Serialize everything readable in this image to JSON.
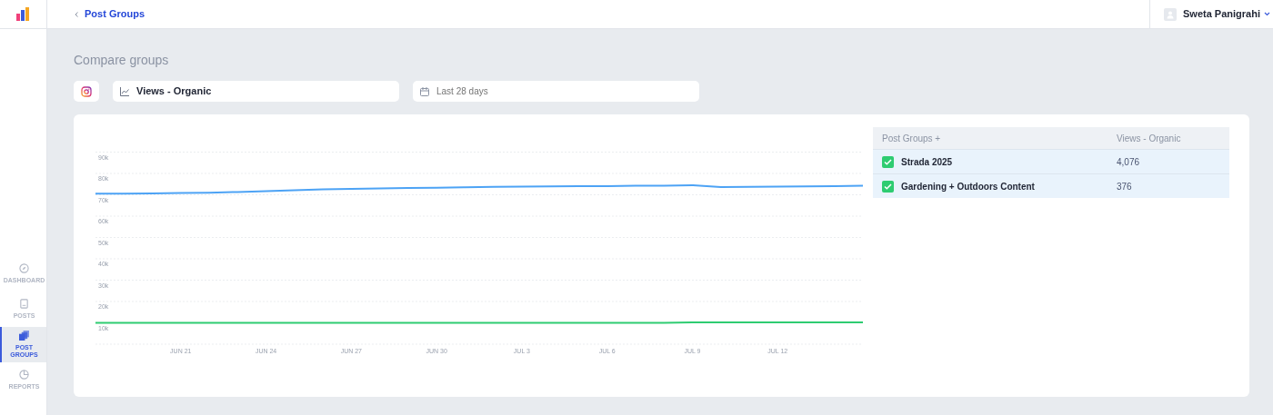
{
  "topbar": {
    "back_link": "Post Groups",
    "user_name": "Sweta Panigrahi"
  },
  "sidebar": {
    "items": [
      {
        "label": "DASHBOARD",
        "selected": false
      },
      {
        "label": "POSTS",
        "selected": false
      },
      {
        "label": "POST GROUPS",
        "selected": true
      },
      {
        "label": "REPORTS",
        "selected": false
      }
    ]
  },
  "page_title": "Compare groups",
  "filters": {
    "metric": "Views - Organic",
    "date_placeholder": "Last 28 days"
  },
  "chart_data": {
    "type": "line",
    "grid": true,
    "categories": [
      null,
      null,
      null,
      "JUN 21",
      null,
      null,
      "JUN 24",
      null,
      null,
      "JUN 27",
      null,
      null,
      "JUN 30",
      null,
      null,
      "JUL 3",
      null,
      null,
      "JUL 6",
      null,
      null,
      "JUL 9",
      null,
      null,
      "JUL 12",
      null,
      null,
      null
    ],
    "ylim": [
      0,
      90000
    ],
    "yticks": [
      {
        "value": 10000,
        "label": "10k"
      },
      {
        "value": 20000,
        "label": "20k"
      },
      {
        "value": 30000,
        "label": "30k"
      },
      {
        "value": 40000,
        "label": "40k"
      },
      {
        "value": 50000,
        "label": "50k"
      },
      {
        "value": 60000,
        "label": "60k"
      },
      {
        "value": 70000,
        "label": "70k"
      },
      {
        "value": 80000,
        "label": "80k"
      },
      {
        "value": 90000,
        "label": "90k"
      }
    ],
    "series": [
      {
        "color": "#4da3f5",
        "values": [
          70500,
          70500,
          70600,
          70800,
          71000,
          71300,
          71700,
          72100,
          72500,
          72800,
          73000,
          73200,
          73300,
          73500,
          73700,
          73800,
          73900,
          74000,
          74100,
          74200,
          74300,
          74500,
          73600,
          73700,
          73800,
          73900,
          74000,
          74200
        ]
      },
      {
        "color": "#2ecc71",
        "values": [
          10000,
          10000,
          10000,
          10000,
          10000,
          10000,
          10000,
          10000,
          10000,
          10000,
          10000,
          10000,
          10000,
          10000,
          10000,
          10000,
          10000,
          10000,
          10000,
          10000,
          10000,
          10200,
          10200,
          10200,
          10200,
          10200,
          10200,
          10200
        ]
      }
    ]
  },
  "table": {
    "columns": [
      "Post Groups +",
      "Views - Organic"
    ],
    "rows": [
      {
        "name": "Strada 2025",
        "value": "4,076",
        "checked": true
      },
      {
        "name": "Gardening + Outdoors Content",
        "value": "376",
        "checked": true
      }
    ]
  }
}
